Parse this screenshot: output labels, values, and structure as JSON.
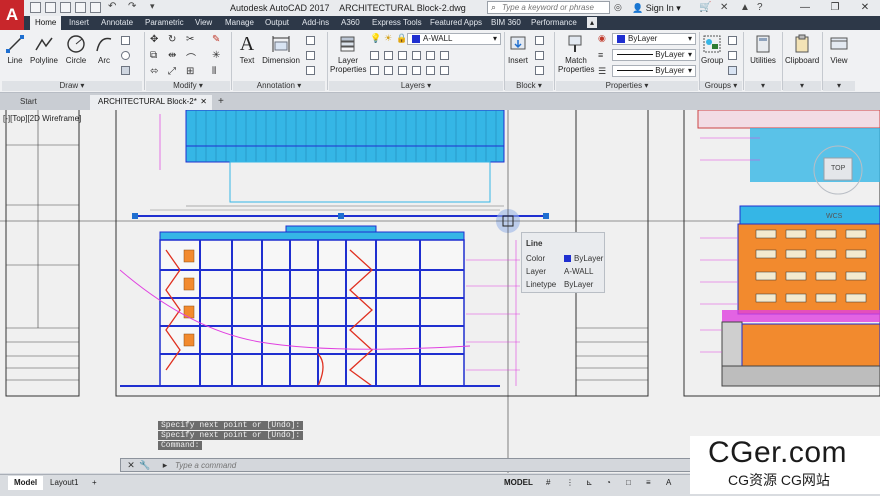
{
  "titlebar": {
    "app_name": "Autodesk AutoCAD 2017",
    "doc_name": "ARCHITECTURAL Block-2.dwg",
    "search_placeholder": "Type a keyword or phrase",
    "sign_in": "Sign In"
  },
  "ribbon_tabs": [
    "Home",
    "Insert",
    "Annotate",
    "Parametric",
    "View",
    "Manage",
    "Output",
    "Add-ins",
    "A360",
    "Express Tools",
    "Featured Apps",
    "BIM 360",
    "Performance"
  ],
  "draw_tools": [
    "Line",
    "Polyline",
    "Circle",
    "Arc"
  ],
  "annotation_tools": [
    "Text",
    "Dimension"
  ],
  "layer_tools": {
    "layer_properties": "Layer\nProperties",
    "current_layer": "A-WALL"
  },
  "block_tools": {
    "insert": "Insert"
  },
  "property_tools": {
    "match_properties": "Match\nProperties",
    "color": "ByLayer",
    "lineweight": "ByLayer",
    "linetype": "ByLayer"
  },
  "group_tools": {
    "group": "Group"
  },
  "utility_tools": [
    "Utilities",
    "Clipboard",
    "View"
  ],
  "panel_labels": {
    "draw": "Draw",
    "modify": "Modify",
    "annotation": "Annotation",
    "layers": "Layers",
    "block": "Block",
    "properties": "Properties",
    "groups": "Groups"
  },
  "file_tabs": {
    "start": "Start",
    "active": "ARCHITECTURAL Block-2*"
  },
  "viewport_label": "[-][Top][2D Wireframe]",
  "viewcube": {
    "top": "TOP",
    "wcs": "WCS"
  },
  "tooltip": {
    "title": "Line",
    "rows": [
      {
        "label": "Color",
        "value": "ByLayer"
      },
      {
        "label": "Layer",
        "value": "A-WALL"
      },
      {
        "label": "Linetype",
        "value": "ByLayer"
      }
    ]
  },
  "command_history": [
    "Specify next point or [Undo]:",
    "Specify next point or [Undo]:",
    "Command:"
  ],
  "command_placeholder": "Type a command",
  "status_tabs": [
    "Model",
    "Layout1"
  ],
  "status_model": "MODEL",
  "watermark": {
    "main": "CGer.com",
    "sub": "CG资源 CG网站"
  },
  "colors": {
    "accent": "#c8262b",
    "ribbon_dark": "#2d3848",
    "cad_blue": "#1f2fd0",
    "cad_cyan": "#35b6e6",
    "cad_orange": "#f28a2e",
    "cad_magenta": "#e040e0"
  }
}
